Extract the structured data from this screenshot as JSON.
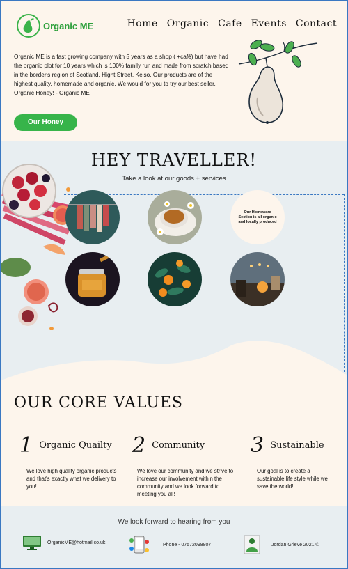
{
  "brand": {
    "name": "Organic ME"
  },
  "nav": {
    "items": [
      "Home",
      "Organic",
      "Cafe",
      "Events",
      "Contact"
    ]
  },
  "intro": {
    "text": "Organic ME is a fast growing company with 5 years as a shop ( +café) but have had the organic plot for 10 years which is 100% family run and made from scratch based in the border's region of Scotland, Hight Street, Kelso. Our products are of the highest quality, homemade and organic. We would for you to try our best seller, Organic Honey! - Organic ME",
    "cta_label": "Our Honey"
  },
  "traveller": {
    "heading": "HEY TRAVELLER!",
    "subheading": "Take a look at our goods + services",
    "homeware_text": "Our Homeware Section is all organic and locally produced"
  },
  "values": {
    "heading": "OUR CORE VALUES",
    "items": [
      {
        "number": "1",
        "title": "Organic Quailty",
        "text": "We love high quality organic products and that's exactly what we delivery to you!"
      },
      {
        "number": "2",
        "title": "Community",
        "text": "We love our community and we strive to increase our involvement within the community and we look forward to meeting you all!"
      },
      {
        "number": "3",
        "title": "Sustainable",
        "text": "Our goal is to create a sustainable life style while we save the world!"
      }
    ]
  },
  "footer": {
    "message": "We look forward to hearing from you",
    "email": "OrganicME@hotmail.co.uk",
    "phone": "Phone - 07572098807",
    "credit": "Jordan Grieve 2021 ©"
  },
  "colors": {
    "accent": "#37b44a",
    "cream": "#fdf5ec",
    "panel": "#e8eef1",
    "border": "#3a78c2"
  }
}
